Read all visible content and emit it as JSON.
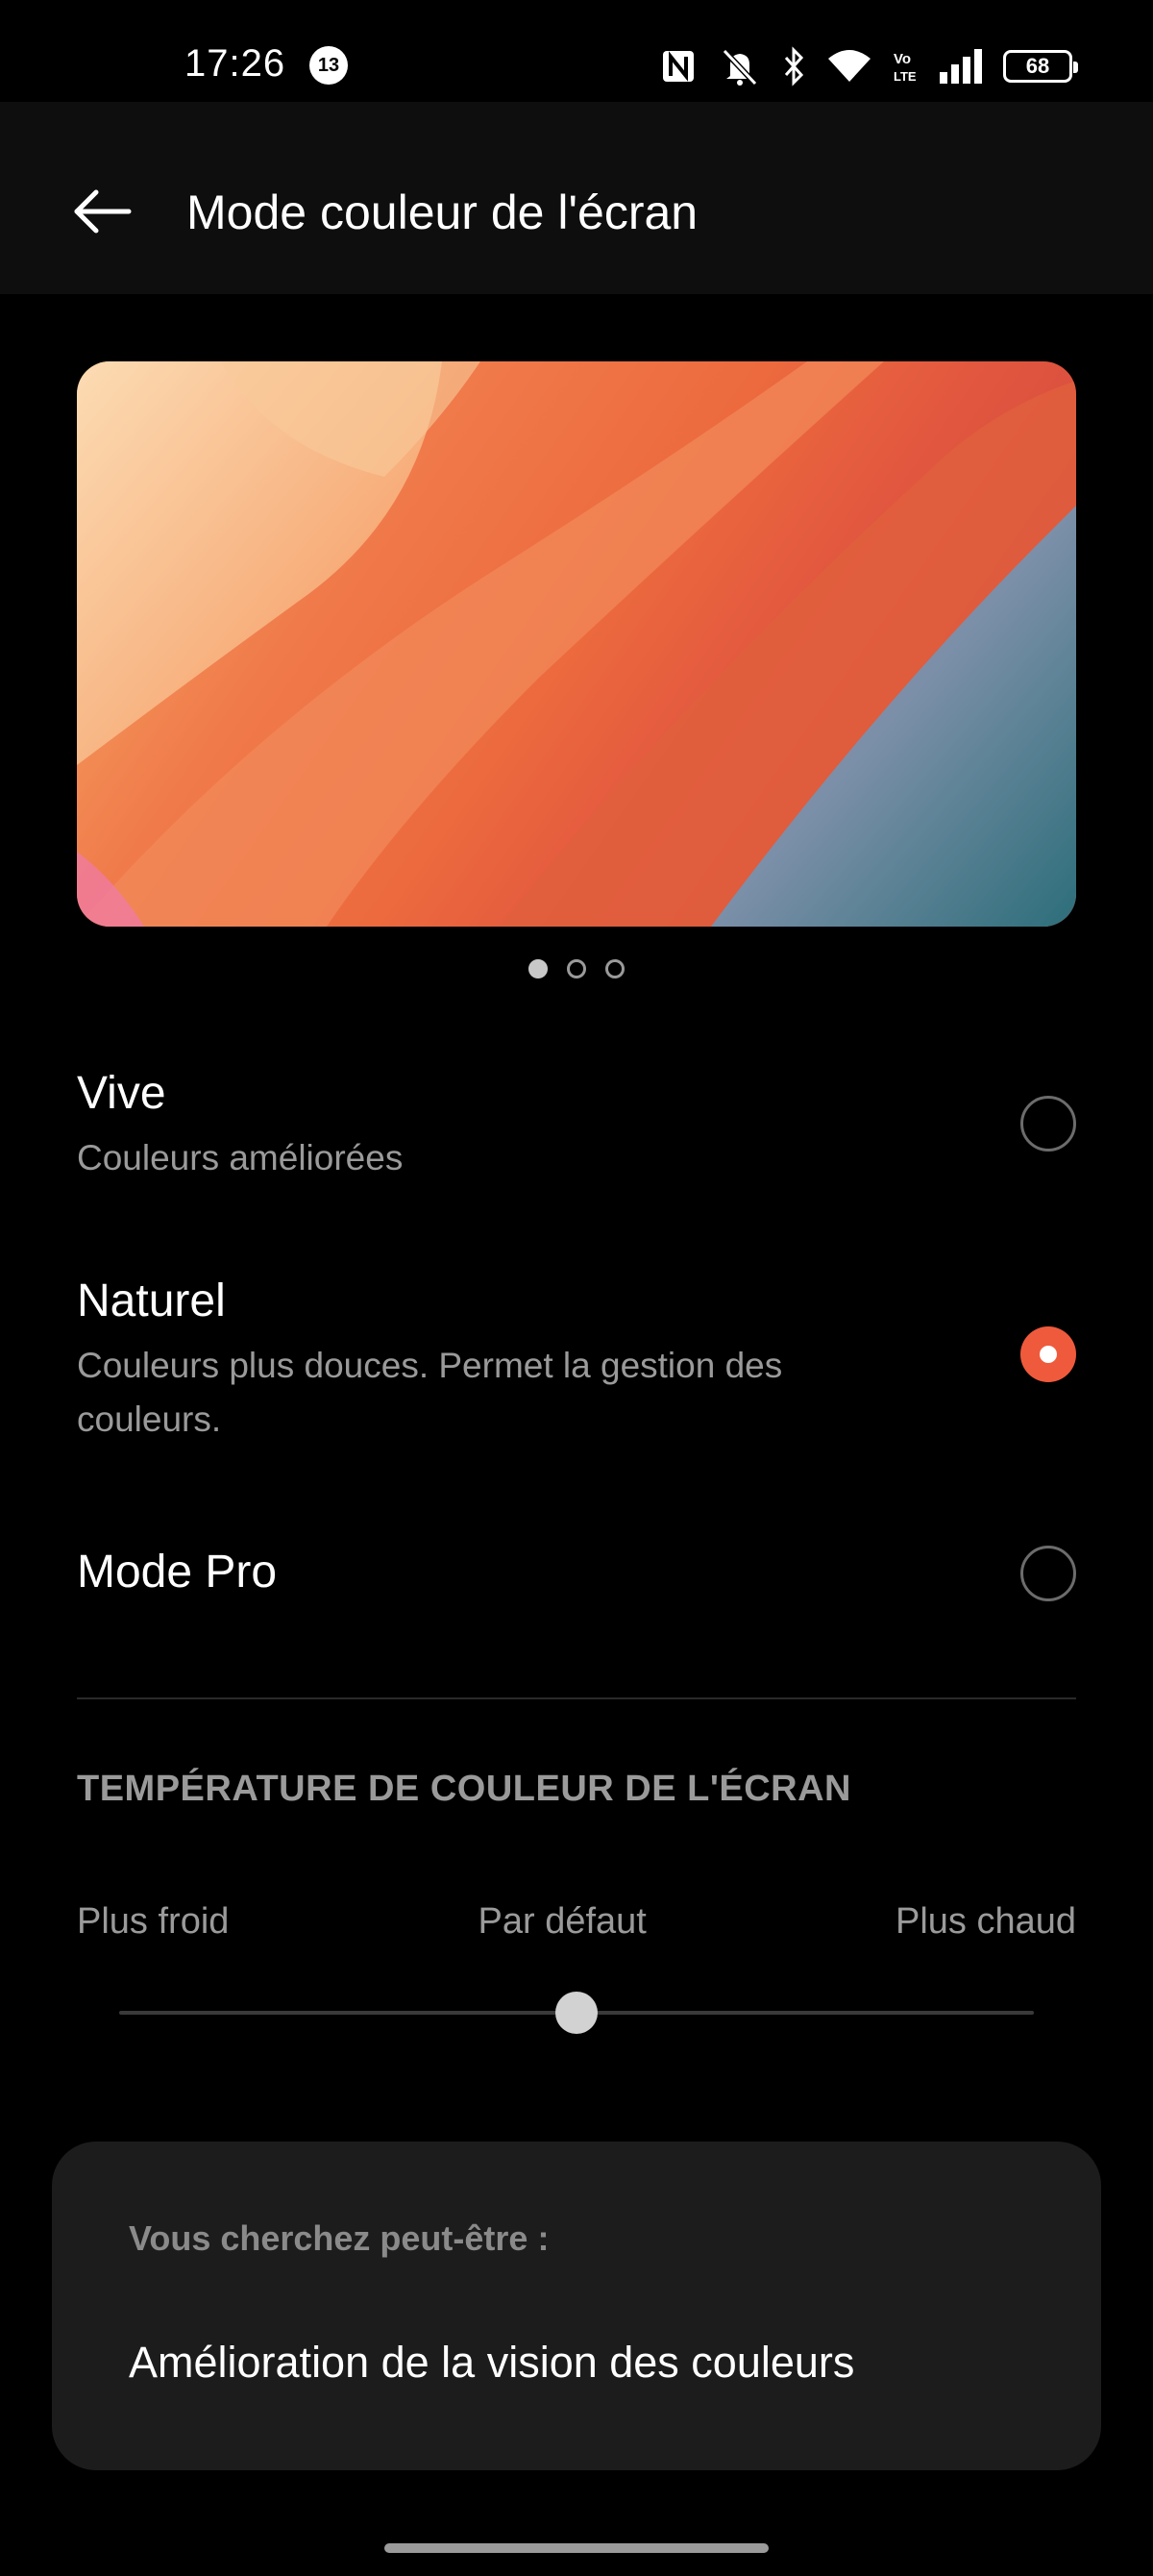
{
  "status_bar": {
    "time": "17:26",
    "notification_count": "13",
    "battery": "68",
    "icons": [
      "nfc-icon",
      "mute-icon",
      "bluetooth-icon",
      "wifi-icon",
      "volte-icon",
      "signal-icon",
      "battery-icon"
    ]
  },
  "header": {
    "title": "Mode couleur de l'écran",
    "back_icon": "arrow-left-icon"
  },
  "preview": {
    "page_count": 3,
    "active_page": 1
  },
  "options": [
    {
      "title": "Vive",
      "subtitle": "Couleurs améliorées",
      "selected": false
    },
    {
      "title": "Naturel",
      "subtitle": "Couleurs plus douces. Permet la gestion des couleurs.",
      "selected": true
    },
    {
      "title": "Mode Pro",
      "subtitle": "",
      "selected": false
    }
  ],
  "temperature": {
    "section_title": "TEMPÉRATURE DE COULEUR DE L'ÉCRAN",
    "label_cold": "Plus froid",
    "label_default": "Par défaut",
    "label_warm": "Plus chaud",
    "value_fraction": 0.5
  },
  "suggestion": {
    "heading": "Vous cherchez peut-être :",
    "link": "Amélioration de la vision des couleurs"
  },
  "colors": {
    "accent": "#ef5a3c",
    "background": "#000000",
    "card": "#1c1c1c"
  }
}
